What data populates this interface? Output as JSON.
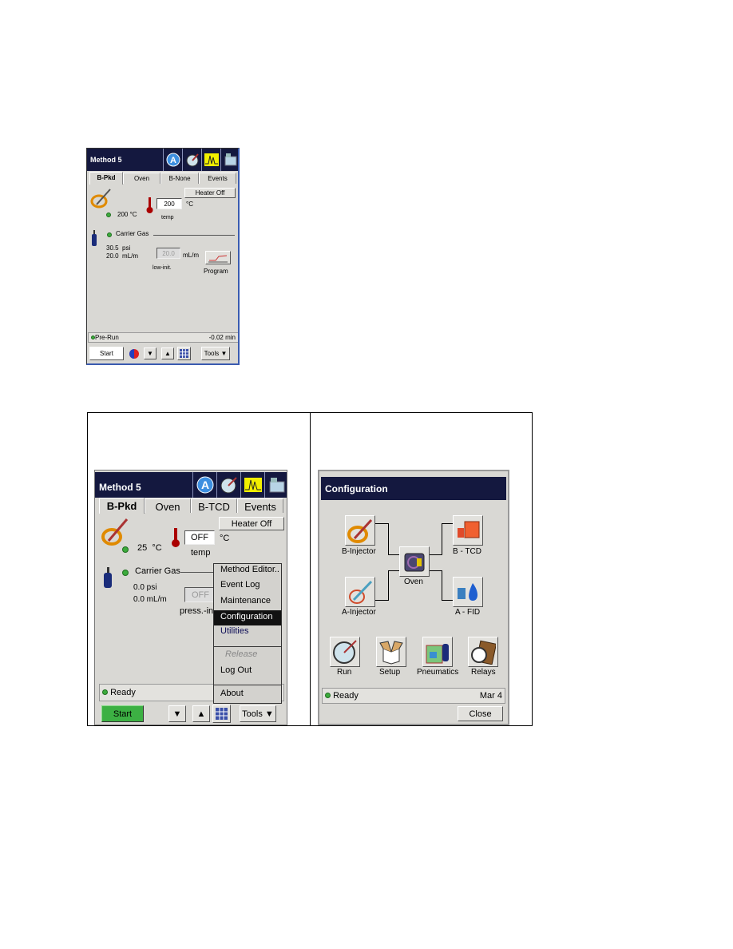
{
  "screen1": {
    "title": "Method 5",
    "header_icons": [
      "autosampler-icon",
      "run-dial-icon",
      "chromatogram-icon",
      "instrument-icon"
    ],
    "tabs": [
      "B-Pkd",
      "Oven",
      "B-None",
      "Events"
    ],
    "heater_button": "Heater Off",
    "actual_temp": "200 °C",
    "temp_setpoint": "200",
    "temp_unit": "°C",
    "temp_label": "temp",
    "carrier_gas": "Carrier Gas",
    "pressure": "30.5",
    "pressure_unit": "psi",
    "flow": "20.0",
    "flow_unit": "mL/m",
    "flow_setpoint": "20.0",
    "flow_setpoint_unit": "mL/m",
    "flow_label": "low-init.",
    "program_label": "Program",
    "status": "Pre-Run",
    "time": "-0.02 min",
    "start": "Start",
    "tools": "Tools"
  },
  "screen2": {
    "title": "Method 5",
    "tabs": [
      "B-Pkd",
      "Oven",
      "B-TCD",
      "Events"
    ],
    "heater_button": "Heater Off",
    "actual_temp": "25",
    "actual_temp_unit": "°C",
    "temp_setpoint": "OFF",
    "temp_unit": "°C",
    "temp_label": "temp",
    "carrier_gas": "Carrier Gas",
    "pressure": "0.0 psi",
    "flow": "0.0 mL/m",
    "press_setpoint": "OFF",
    "press_label": "press.-ini",
    "status": "Ready",
    "start": "Start",
    "tools": "Tools",
    "menu": [
      "Method Editor..",
      "Event Log",
      "Maintenance",
      "Configuration",
      "Utilities",
      "Release",
      "Log Out",
      "About"
    ],
    "menu_selected": "Configuration",
    "start_color": "#3cb043"
  },
  "screen3": {
    "title": "Configuration",
    "modules": {
      "b_injector": "B-Injector",
      "a_injector": "A-Injector",
      "oven": "Oven",
      "b_tcd": "B - TCD",
      "a_fid": "A - FID"
    },
    "actions": [
      "Run",
      "Setup",
      "Pneumatics",
      "Relays"
    ],
    "status": "Ready",
    "date": "Mar 4",
    "close": "Close"
  },
  "colors": {
    "title_bar": "#14183f",
    "status_led": "#3cab3c",
    "highlight": "#111111"
  }
}
